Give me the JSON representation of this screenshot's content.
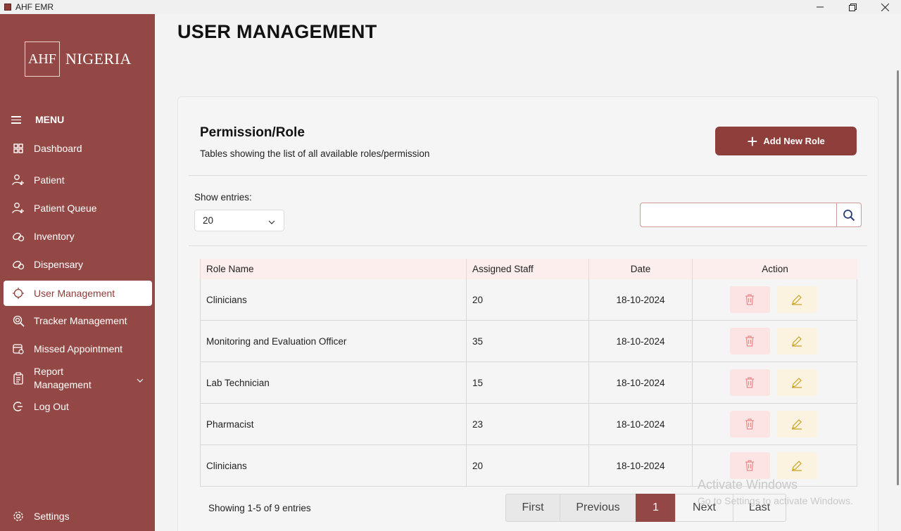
{
  "window": {
    "title": "AHF EMR",
    "controls": [
      "—",
      "❐",
      "✕"
    ]
  },
  "sidebar": {
    "logo_box": "AHF",
    "logo_text": "NIGERIA",
    "menu_label": "MENU",
    "items": [
      {
        "label": "Dashboard",
        "icon": "dashboard-icon"
      },
      {
        "label": "Patient",
        "icon": "patient-icon"
      },
      {
        "label": "Patient Queue",
        "icon": "queue-icon"
      },
      {
        "label": "Inventory",
        "icon": "inventory-icon"
      },
      {
        "label": "Dispensary",
        "icon": "dispensary-icon"
      },
      {
        "label": "User Management",
        "icon": "user-management-icon",
        "active": true
      },
      {
        "label": "Tracker Management",
        "icon": "tracker-icon"
      },
      {
        "label": "Missed Appointment",
        "icon": "calendar-icon"
      },
      {
        "label": "Report Management",
        "icon": "clipboard-icon"
      },
      {
        "label": "Log Out",
        "icon": "logout-icon"
      }
    ],
    "settings_label": "Settings"
  },
  "page": {
    "title": "USER MANAGEMENT"
  },
  "card": {
    "title": "Permission/Role",
    "subtitle": "Tables showing the list of all available roles/permission",
    "add_button": "Add New Role",
    "show_entries_label": "Show entries:",
    "entries_value": "20",
    "search_placeholder": ""
  },
  "table": {
    "headers": [
      "Role Name",
      "Assigned Staff",
      "Date",
      "Action"
    ],
    "rows": [
      {
        "role": "Clinicians",
        "staff": "20",
        "date": "18-10-2024"
      },
      {
        "role": "Monitoring and Evaluation Officer",
        "staff": "35",
        "date": "18-10-2024"
      },
      {
        "role": "Lab Technician",
        "staff": "15",
        "date": "18-10-2024"
      },
      {
        "role": "Pharmacist",
        "staff": "23",
        "date": "18-10-2024"
      },
      {
        "role": "Clinicians",
        "staff": "20",
        "date": "18-10-2024"
      }
    ]
  },
  "footer": {
    "showing": "Showing 1-5 of 9 entries",
    "pager": {
      "first": "First",
      "prev": "Previous",
      "current": "1",
      "next": "Next",
      "last": "Last"
    }
  },
  "watermark": {
    "line1": "Activate Windows",
    "line2": "Go to Settings to activate Windows."
  },
  "colors": {
    "brand": "#944845",
    "active_text": "#8e3c38",
    "delete_bg": "#fde4e4",
    "edit_bg": "#fbf3df",
    "header_bg": "#fdeeee"
  }
}
